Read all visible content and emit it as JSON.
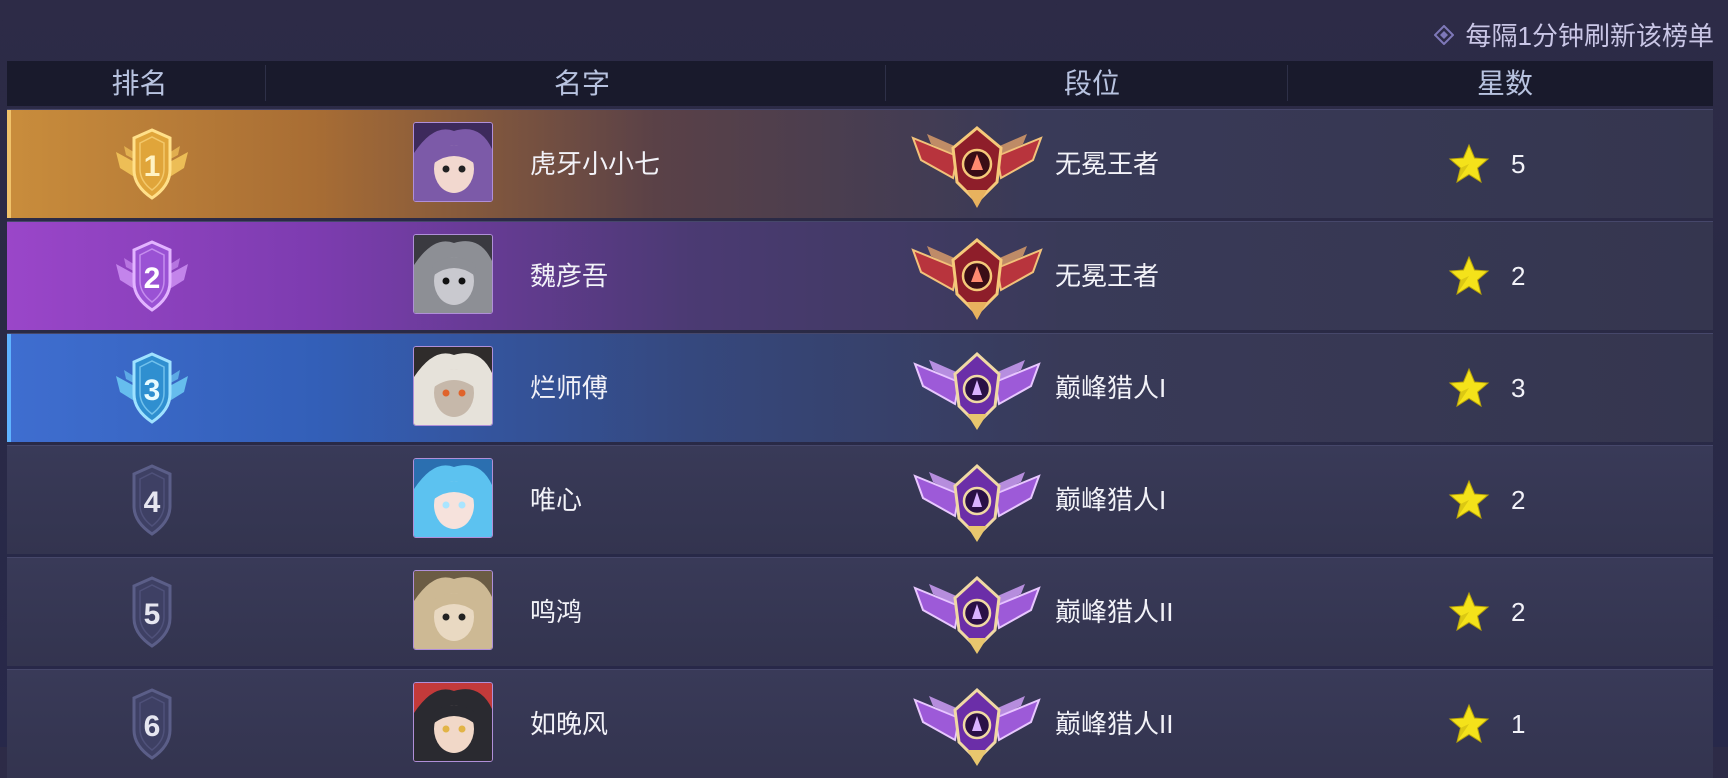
{
  "header": {
    "refresh_note": "每隔1分钟刷新该榜单"
  },
  "columns": {
    "rank": "排名",
    "name": "名字",
    "tier": "段位",
    "stars": "星数"
  },
  "rows": [
    {
      "rank": "1",
      "name": "虎牙小小七",
      "tier": "无冕王者",
      "stars": "5",
      "rank_style": "gold",
      "tier_style": "king",
      "avatar": "purple-hair-glasses"
    },
    {
      "rank": "2",
      "name": "魏彦吾",
      "tier": "无冕王者",
      "stars": "2",
      "rank_style": "purple",
      "tier_style": "king",
      "avatar": "grey-wolf"
    },
    {
      "rank": "3",
      "name": "烂师傅",
      "tier": "巅峰猎人I",
      "stars": "3",
      "rank_style": "blue",
      "tier_style": "hunter",
      "avatar": "white-hair-mask"
    },
    {
      "rank": "4",
      "name": "唯心",
      "tier": "巅峰猎人I",
      "stars": "2",
      "rank_style": "plain",
      "tier_style": "hunter",
      "avatar": "blue-hair"
    },
    {
      "rank": "5",
      "name": "鸣鸿",
      "tier": "巅峰猎人II",
      "stars": "2",
      "rank_style": "plain",
      "tier_style": "hunter",
      "avatar": "blonde-mask"
    },
    {
      "rank": "6",
      "name": "如晚风",
      "tier": "巅峰猎人II",
      "stars": "1",
      "rank_style": "plain",
      "tier_style": "hunter",
      "avatar": "goggles-girl"
    }
  ],
  "colors": {
    "gold": "#f0c040",
    "purple": "#b46ae6",
    "blue": "#4fb3f5",
    "star": "#f4e21a"
  }
}
